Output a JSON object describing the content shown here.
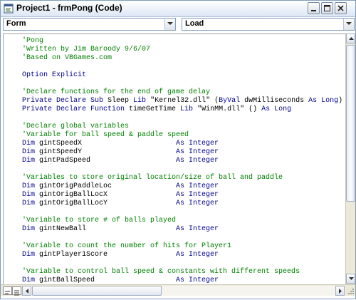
{
  "window": {
    "title": "Project1 - frmPong (Code)"
  },
  "object_combo": {
    "value": "Form"
  },
  "procedure_combo": {
    "value": "Load"
  },
  "code_lines": [
    {
      "segments": [
        {
          "t": "'Pong",
          "c": "cm"
        }
      ]
    },
    {
      "segments": [
        {
          "t": "'Written by Jim Baroody 9/6/07",
          "c": "cm"
        }
      ]
    },
    {
      "segments": [
        {
          "t": "'Based on VBGames.com",
          "c": "cm"
        }
      ]
    },
    {
      "segments": []
    },
    {
      "segments": [
        {
          "t": "Option Explicit",
          "c": "kw"
        }
      ]
    },
    {
      "segments": []
    },
    {
      "segments": [
        {
          "t": "'Declare functions for the end of game delay",
          "c": "cm"
        }
      ]
    },
    {
      "segments": [
        {
          "t": "Private Declare Sub ",
          "c": "kw"
        },
        {
          "t": "Sleep ",
          "c": ""
        },
        {
          "t": "Lib ",
          "c": "kw"
        },
        {
          "t": "\"Kernel32.dll\" (",
          "c": ""
        },
        {
          "t": "ByVal ",
          "c": "kw"
        },
        {
          "t": "dwMilliseconds ",
          "c": ""
        },
        {
          "t": "As Long",
          "c": "kw"
        },
        {
          "t": ")",
          "c": ""
        }
      ]
    },
    {
      "segments": [
        {
          "t": "Private Declare Function ",
          "c": "kw"
        },
        {
          "t": "timeGetTime ",
          "c": ""
        },
        {
          "t": "Lib ",
          "c": "kw"
        },
        {
          "t": "\"WinMM.dll\" () ",
          "c": ""
        },
        {
          "t": "As Long",
          "c": "kw"
        }
      ]
    },
    {
      "segments": []
    },
    {
      "segments": [
        {
          "t": "'Declare global variables",
          "c": "cm"
        }
      ]
    },
    {
      "segments": [
        {
          "t": "'Variable for ball speed & paddle speed",
          "c": "cm"
        }
      ]
    },
    {
      "segments": [
        {
          "t": "Dim ",
          "c": "kw"
        },
        {
          "t": "gintSpeedX                      ",
          "c": ""
        },
        {
          "t": "As Integer",
          "c": "kw"
        }
      ]
    },
    {
      "segments": [
        {
          "t": "Dim ",
          "c": "kw"
        },
        {
          "t": "gintSpeedY                      ",
          "c": ""
        },
        {
          "t": "As Integer",
          "c": "kw"
        }
      ]
    },
    {
      "segments": [
        {
          "t": "Dim ",
          "c": "kw"
        },
        {
          "t": "gintPadSpeed                    ",
          "c": ""
        },
        {
          "t": "As Integer",
          "c": "kw"
        }
      ]
    },
    {
      "segments": []
    },
    {
      "segments": [
        {
          "t": "'Variables to store original location/size of ball and paddle",
          "c": "cm"
        }
      ]
    },
    {
      "segments": [
        {
          "t": "Dim ",
          "c": "kw"
        },
        {
          "t": "gintOrigPaddleLoc               ",
          "c": ""
        },
        {
          "t": "As Integer",
          "c": "kw"
        }
      ]
    },
    {
      "segments": [
        {
          "t": "Dim ",
          "c": "kw"
        },
        {
          "t": "gintOrigBallLocX                ",
          "c": ""
        },
        {
          "t": "As Integer",
          "c": "kw"
        }
      ]
    },
    {
      "segments": [
        {
          "t": "Dim ",
          "c": "kw"
        },
        {
          "t": "gintOrigBallLocY                ",
          "c": ""
        },
        {
          "t": "As Integer",
          "c": "kw"
        }
      ]
    },
    {
      "segments": []
    },
    {
      "segments": [
        {
          "t": "'Variable to store # of balls played",
          "c": "cm"
        }
      ]
    },
    {
      "segments": [
        {
          "t": "Dim ",
          "c": "kw"
        },
        {
          "t": "gintNewBall                     ",
          "c": ""
        },
        {
          "t": "As Integer",
          "c": "kw"
        }
      ]
    },
    {
      "segments": []
    },
    {
      "segments": [
        {
          "t": "'Variable to count the number of hits for Player1",
          "c": "cm"
        }
      ]
    },
    {
      "segments": [
        {
          "t": "Dim ",
          "c": "kw"
        },
        {
          "t": "gintPlayer1Score                ",
          "c": ""
        },
        {
          "t": "As Integer",
          "c": "kw"
        }
      ]
    },
    {
      "segments": []
    },
    {
      "segments": [
        {
          "t": "'Variable to control ball speed & constants with different speeds",
          "c": "cm"
        }
      ]
    },
    {
      "segments": [
        {
          "t": "Dim ",
          "c": "kw"
        },
        {
          "t": "gintBallSpeed                   ",
          "c": ""
        },
        {
          "t": "As Integer",
          "c": "kw"
        }
      ]
    }
  ],
  "icons": {
    "app": "vb-code-window-icon",
    "minimize": "minimize-icon",
    "maximize": "maximize-icon",
    "close": "close-icon",
    "dropdown": "chevron-down-icon",
    "scroll_up": "arrow-up-icon",
    "scroll_down": "arrow-down-icon",
    "scroll_left": "arrow-left-icon",
    "scroll_right": "arrow-right-icon",
    "procedure_view": "procedure-view-icon",
    "full_module_view": "full-module-view-icon",
    "resize": "resize-grip-icon"
  },
  "colors": {
    "keyword": "#00008b",
    "comment": "#008000",
    "text": "#000000",
    "accent": "#7f9db9"
  }
}
